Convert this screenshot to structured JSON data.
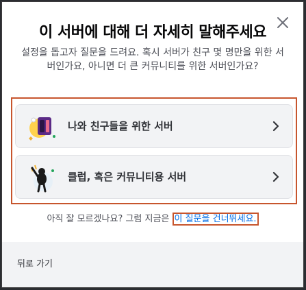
{
  "modal": {
    "title": "이 서버에 대해 더 자세히 말해주세요",
    "subtitle": "설정을 돕고자 질문을 드려요. 혹시 서버가 친구 몇 명만을 위한 서버인가요, 아니면 더 큰 커뮤니티를 위한 서버인가요?",
    "close_icon": "close-icon"
  },
  "options": [
    {
      "label": "나와 친구들을 위한 서버",
      "icon": "friends-illustration-icon"
    },
    {
      "label": "클럽, 혹은 커뮤니티용 서버",
      "icon": "community-illustration-icon"
    }
  ],
  "skip": {
    "prefix": "아직 잘 모르겠나요? 그럼 지금은 ",
    "link": "이 질문을 건너뛰세요."
  },
  "footer": {
    "back_label": "뒤로 가기"
  },
  "colors": {
    "accent_link": "#006ce7",
    "highlight_border": "#c7552d",
    "title_text": "#060607"
  }
}
